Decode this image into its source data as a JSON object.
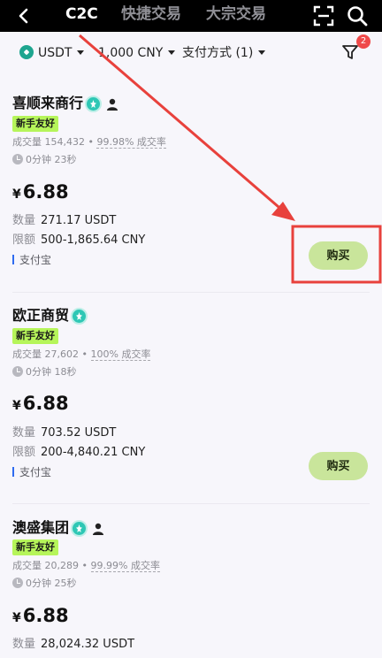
{
  "topbar": {
    "tabs": [
      {
        "label": "C2C",
        "active": true
      },
      {
        "label": "快捷交易",
        "active": false
      },
      {
        "label": "大宗交易",
        "active": false
      }
    ],
    "icons": [
      "back-icon",
      "scan-icon",
      "search-icon"
    ]
  },
  "filters": {
    "asset": "USDT",
    "amount": "1,000 CNY",
    "payment": "支付方式 (1)",
    "filter_badge": "2"
  },
  "merchants": [
    {
      "name": "喜顺来商行",
      "verified": true,
      "person_badge": true,
      "tag": "新手友好",
      "stats_volume": "成交量 154,432",
      "stats_dot": "•",
      "stats_rate": "99.98% 成交率",
      "time": "0分钟 23秒",
      "currency": "¥",
      "price": "6.88",
      "qty_label": "数量",
      "qty": "271.17 USDT",
      "limit_label": "限额",
      "limit": "500-1,865.64 CNY",
      "payment": "支付宝",
      "buy_label": "购买"
    },
    {
      "name": "欧正商贸",
      "verified": true,
      "person_badge": false,
      "tag": "新手友好",
      "stats_volume": "成交量 27,602",
      "stats_dot": "•",
      "stats_rate": "100% 成交率",
      "time": "0分钟 18秒",
      "currency": "¥",
      "price": "6.88",
      "qty_label": "数量",
      "qty": "703.52 USDT",
      "limit_label": "限额",
      "limit": "200-4,840.21 CNY",
      "payment": "支付宝",
      "buy_label": "购买"
    },
    {
      "name": "澳盛集团",
      "verified": true,
      "person_badge": true,
      "tag": "新手友好",
      "stats_volume": "成交量 20,289",
      "stats_dot": "•",
      "stats_rate": "99.99% 成交率",
      "time": "0分钟 25秒",
      "currency": "¥",
      "price": "6.88",
      "qty_label": "数量",
      "qty": "28,024.32 USDT"
    }
  ],
  "colors": {
    "accent_green": "#b6f55a",
    "buy_button": "#c9e59b",
    "verify_teal": "#2ec7b5",
    "annotation_red": "#e8413c",
    "badge_red": "#ef4a4a"
  }
}
